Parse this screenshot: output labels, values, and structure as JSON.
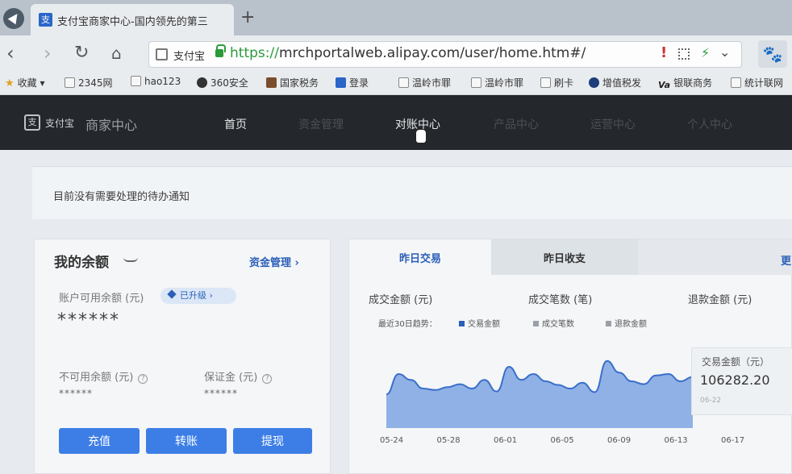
{
  "browser": {
    "tab_title": "支付宝商家中心-国内领先的第三",
    "new_tab": "+",
    "site_name": "支付宝",
    "url_scheme": "https://",
    "url_rest": "mrchportalweb.alipay.com/user/home.htm#/"
  },
  "bookmarks": [
    {
      "label": "收藏",
      "icon": "star-icon"
    },
    {
      "label": "2345网",
      "icon": "2345-icon"
    },
    {
      "label": "hao123",
      "icon": "page-icon"
    },
    {
      "label": "360安全",
      "icon": "360-icon"
    },
    {
      "label": "国家税务",
      "icon": "tax-icon"
    },
    {
      "label": "登录",
      "icon": "alipay-icon"
    },
    {
      "label": "温岭市罪",
      "icon": "page-icon"
    },
    {
      "label": "温岭市罪",
      "icon": "page-icon"
    },
    {
      "label": "刷卡",
      "icon": "page-icon"
    },
    {
      "label": "增值税发",
      "icon": "vat-icon"
    },
    {
      "label": "银联商务",
      "icon": "unionpay-icon"
    },
    {
      "label": "统计联网",
      "icon": "page-icon"
    }
  ],
  "site": {
    "logo_mark": "支",
    "logo_text": "支付宝",
    "logo_sub": "商家中心",
    "nav": [
      "首页",
      "资金管理",
      "对账中心",
      "产品中心",
      "运营中心",
      "个人中心"
    ]
  },
  "notice": "目前没有需要处理的待办通知",
  "balance": {
    "title": "我的余额",
    "fund_link": "资金管理 ›",
    "available_label": "账户可用余额 (元)",
    "upgrade_badge": "已升级 ›",
    "available_value": "******",
    "unavailable_label": "不可用余额 (元)",
    "unavailable_value": "******",
    "deposit_label": "保证金 (元)",
    "deposit_value": "******",
    "buttons": [
      "充值",
      "转账",
      "提现"
    ]
  },
  "transactions": {
    "tabs": [
      "昨日交易",
      "昨日收支"
    ],
    "metrics": [
      "成交金额 (元)",
      "成交笔数 (笔)",
      "退款金额 (元)"
    ],
    "trend_label": "最近30日趋势：",
    "legend": [
      {
        "label": "交易金额",
        "color": "#2b5fb8"
      },
      {
        "label": "成交笔数",
        "color": "#9aa0a6"
      },
      {
        "label": "退款金额",
        "color": "#9aa0a6"
      }
    ],
    "tooltip_label": "交易金额（元）",
    "tooltip_value": "106282.20",
    "tooltip_date": "06-22"
  },
  "chart_data": {
    "type": "area",
    "title": "",
    "xlabel": "",
    "ylabel": "",
    "x_ticks": [
      "05-24",
      "05-28",
      "06-01",
      "06-05",
      "06-09",
      "06-13",
      "06-17"
    ],
    "y_shape_note": "",
    "series": [
      {
        "values": [
          0.42,
          0.7,
          0.62,
          0.5,
          0.48,
          0.52,
          0.56,
          0.5,
          0.62,
          0.46,
          0.8,
          0.62,
          0.7,
          0.6,
          0.55,
          0.5,
          0.58,
          0.45,
          0.88,
          0.72,
          0.6,
          0.56,
          0.68,
          0.7,
          0.6,
          0.66
        ]
      }
    ]
  }
}
